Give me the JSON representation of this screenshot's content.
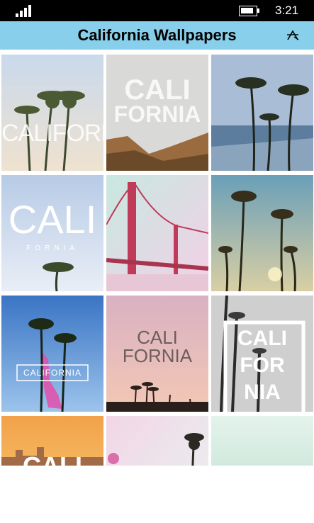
{
  "status_bar": {
    "time": "3:21"
  },
  "header": {
    "title": "California Wallpapers",
    "bg_color": "#87cfea",
    "action_icon": "sort-icon"
  },
  "tiles": [
    {
      "label": "CALIFORNIA",
      "scene": "palms-sunset"
    },
    {
      "label_lines": [
        "CALI",
        "FORNIA"
      ],
      "scene": "cliffs"
    },
    {
      "scene": "beach-palms"
    },
    {
      "label": "CALI",
      "sub_label": "FORNIA",
      "scene": "sky-palm"
    },
    {
      "scene": "golden-gate"
    },
    {
      "scene": "palms-sky"
    },
    {
      "label": "CALIFORNIA",
      "scene": "blue-palms"
    },
    {
      "label_lines": [
        "CALI",
        "FORNIA"
      ],
      "scene": "pink-sunset"
    },
    {
      "label_lines": [
        "CALI",
        "FOR",
        "NIA"
      ],
      "scene": "bw-palms"
    },
    {
      "label": "CALI",
      "scene": "orange-city"
    },
    {
      "scene": "pastel-palm"
    },
    {
      "scene": "mint-sky"
    }
  ]
}
